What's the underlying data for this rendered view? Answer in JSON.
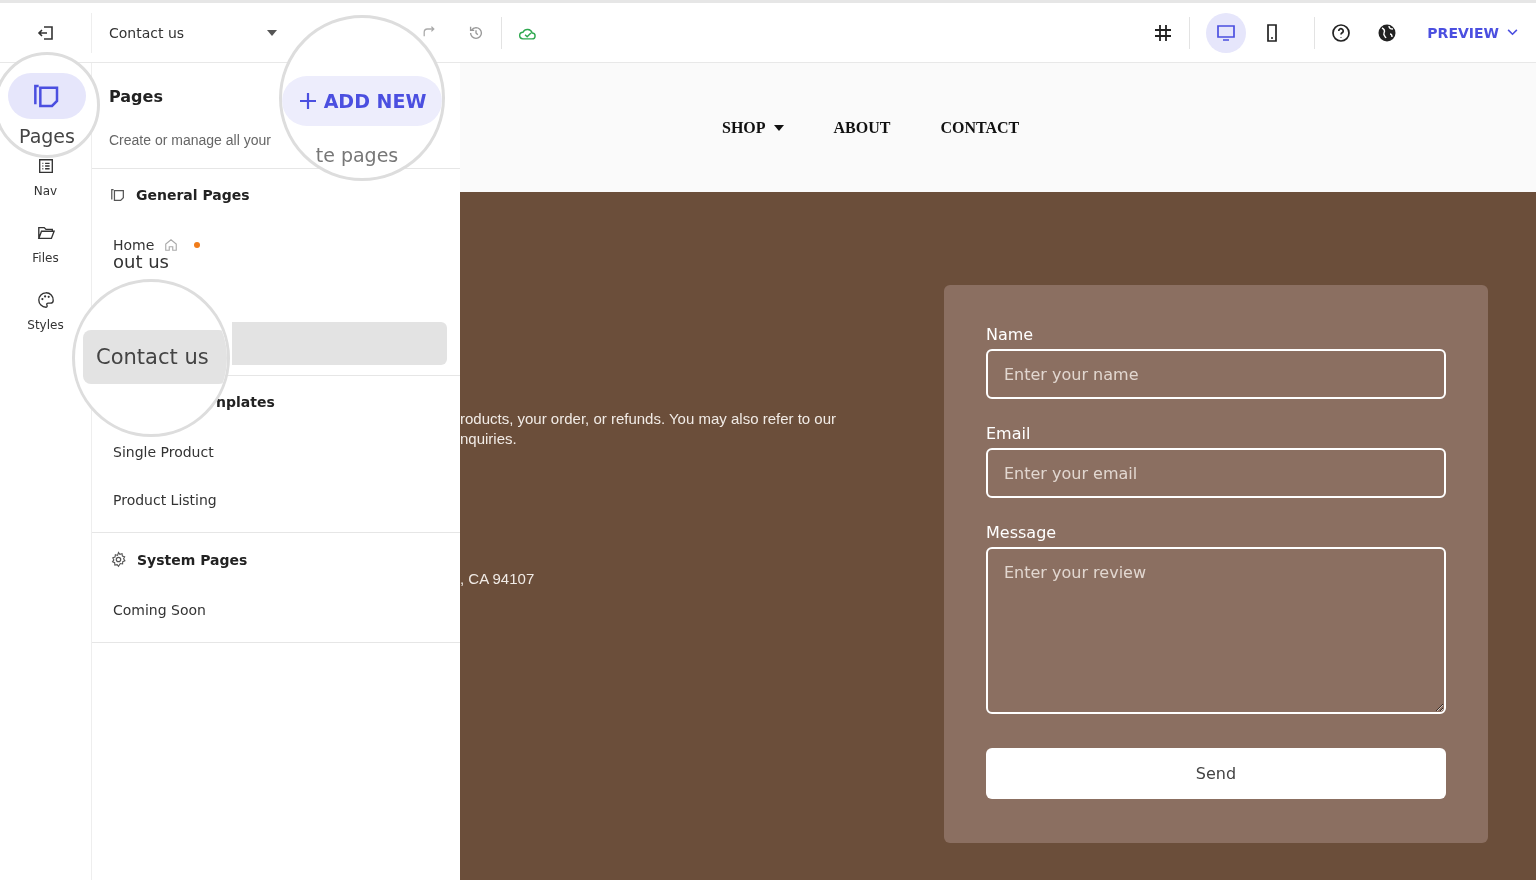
{
  "toolbar": {
    "page_select": "Contact us",
    "devices": [
      {
        "kind": "desktop",
        "selected": true
      },
      {
        "kind": "mobile",
        "selected": false
      }
    ],
    "preview": "PREVIEW"
  },
  "rail": [
    {
      "label": "Pages",
      "kind": "pages",
      "selected": true
    },
    {
      "label": "Nav",
      "kind": "nav",
      "selected": false
    },
    {
      "label": "Files",
      "kind": "files",
      "selected": false
    },
    {
      "label": "Styles",
      "kind": "styles",
      "selected": false
    }
  ],
  "panel": {
    "title": "Pages",
    "add_button": "ADD NEW",
    "description": "Create or manage all your",
    "description_fragment": "te pages",
    "sections": [
      {
        "title": "General Pages",
        "items": [
          {
            "label": "Home",
            "home": true,
            "modified": true,
            "selected": false
          },
          {
            "label": "out us",
            "home": false,
            "modified": false,
            "selected": false
          },
          {
            "label": "Contact us",
            "home": false,
            "modified": false,
            "selected": true
          }
        ]
      },
      {
        "title": "nplates",
        "items": [
          {
            "label": "Single Product",
            "home": false,
            "modified": false,
            "selected": false
          },
          {
            "label": "Product Listing",
            "home": false,
            "modified": false,
            "selected": false
          }
        ]
      },
      {
        "title": "System Pages",
        "items": [
          {
            "label": "Coming Soon",
            "home": false,
            "modified": false,
            "selected": false
          }
        ]
      }
    ]
  },
  "site": {
    "nav": [
      {
        "label": "SHOP",
        "dropdown": true
      },
      {
        "label": "ABOUT",
        "dropdown": false
      },
      {
        "label": "CONTACT",
        "dropdown": false
      }
    ],
    "text_lines": [
      "roducts, your order, or refunds. You may also refer to our",
      "nquiries."
    ],
    "address": ", CA 94107",
    "form": {
      "fields": [
        {
          "label": "Name",
          "placeholder": "Enter your name",
          "kind": "input"
        },
        {
          "label": "Email",
          "placeholder": "Enter your email",
          "kind": "input"
        },
        {
          "label": "Message",
          "placeholder": "Enter your review",
          "kind": "textarea"
        }
      ],
      "submit": "Send"
    }
  }
}
